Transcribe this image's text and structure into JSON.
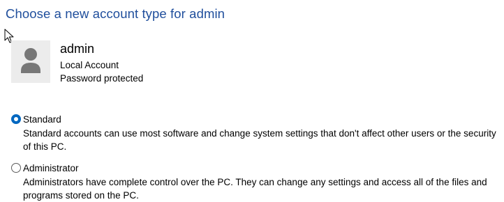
{
  "page": {
    "title": "Choose a new account type for admin"
  },
  "user": {
    "name": "admin",
    "account_type": "Local Account",
    "password_status": "Password protected",
    "avatar_icon": "user-avatar-icon"
  },
  "options": [
    {
      "label": "Standard",
      "description": "Standard accounts can use most software and change system settings that don't affect other users or the security of this PC.",
      "selected": true
    },
    {
      "label": "Administrator",
      "description": "Administrators have complete control over the PC. They can change any settings and access all of the files and programs stored on the PC.",
      "selected": false
    }
  ],
  "colors": {
    "title": "#1f4e9c",
    "radio_accent": "#0067c0",
    "avatar_bg": "#ececec",
    "avatar_fg": "#777777"
  }
}
